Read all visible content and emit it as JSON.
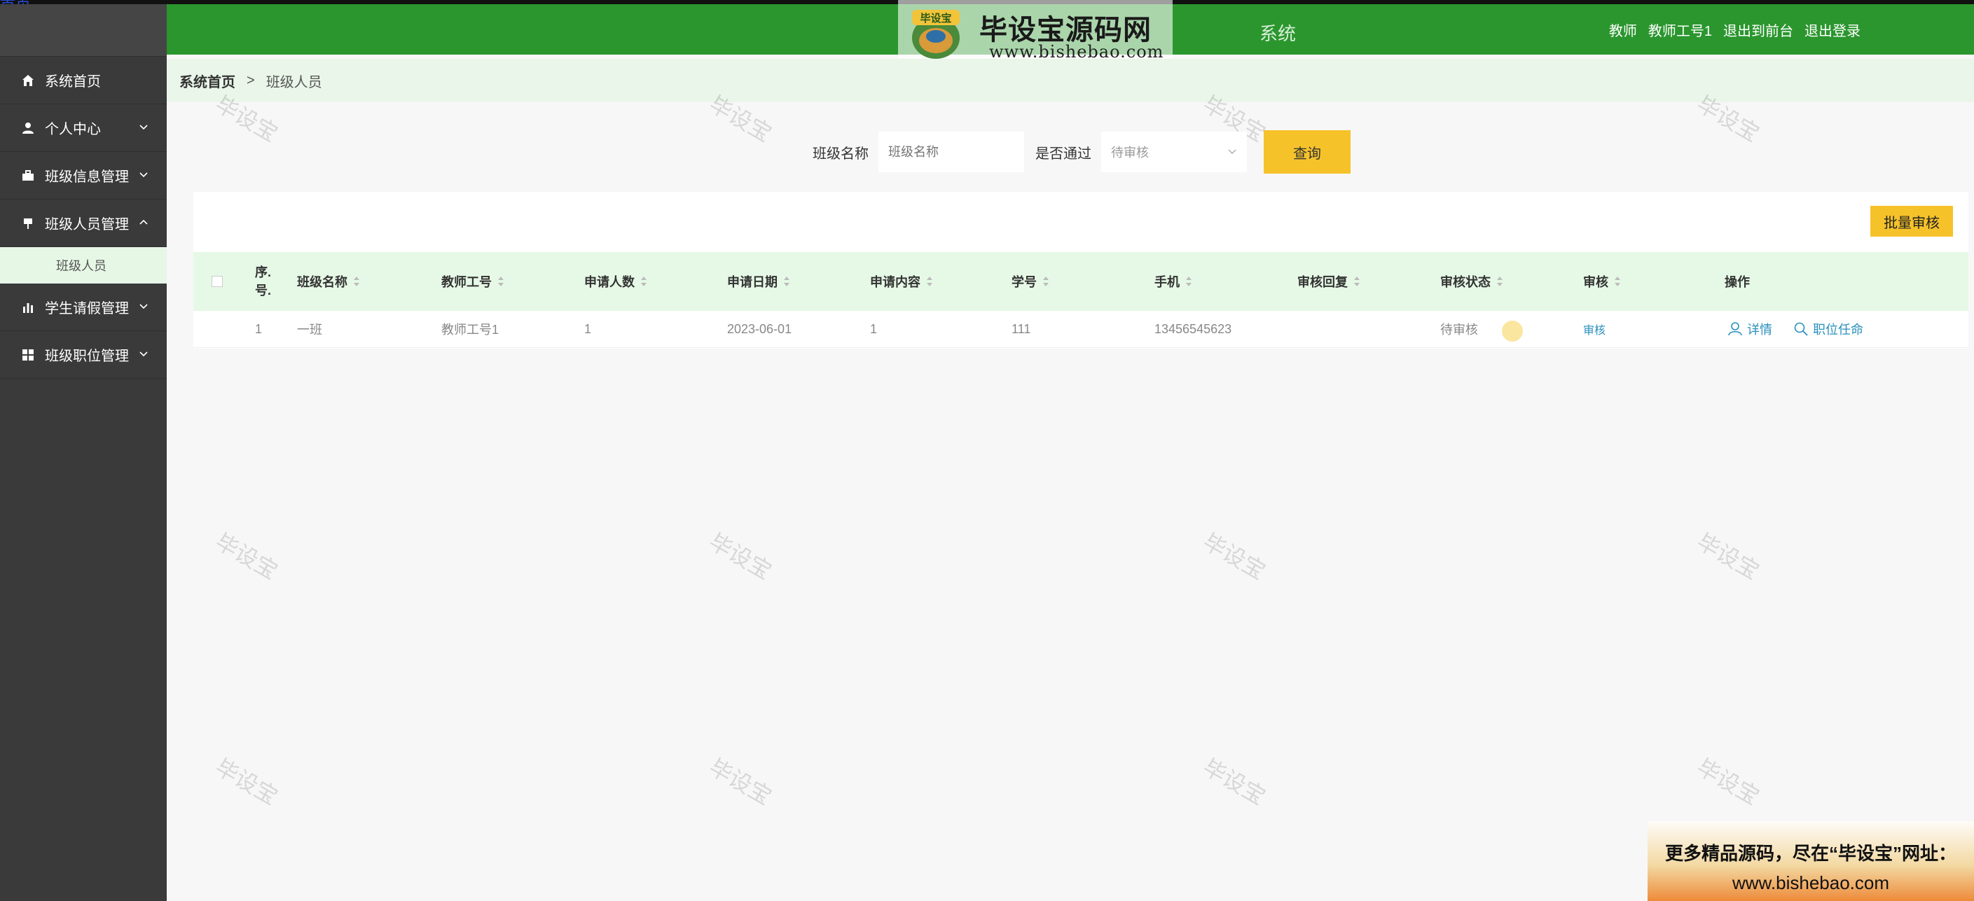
{
  "top_strip_label": "首页",
  "header": {
    "brand_name": "毕设宝源码网",
    "brand_url": "www.bishebao.com",
    "brand_logo_text": "毕设宝",
    "system_title": "系统",
    "user_role": "教师",
    "user_name": "教师工号1",
    "link_front": "退出到前台",
    "link_logout": "退出登录"
  },
  "sidebar": {
    "items": [
      {
        "label": "系统首页",
        "icon": "home-icon"
      },
      {
        "label": "个人中心",
        "icon": "user-icon"
      },
      {
        "label": "班级信息管理",
        "icon": "briefcase-icon"
      },
      {
        "label": "班级人员管理",
        "icon": "flag-icon"
      },
      {
        "label": "学生请假管理",
        "icon": "bar-chart-icon"
      },
      {
        "label": "班级职位管理",
        "icon": "grid-icon"
      }
    ],
    "sub_item": "班级人员"
  },
  "breadcrumb": {
    "home": "系统首页",
    "separator": ">",
    "current": "班级人员"
  },
  "search": {
    "class_name_label": "班级名称",
    "class_name_placeholder": "班级名称",
    "passed_label": "是否通过",
    "passed_value": "待审核",
    "query_button": "查询"
  },
  "table": {
    "batch_button": "批量审核",
    "columns": {
      "index_line1": "序.",
      "index_line2": "号.",
      "class_name": "班级名称",
      "teacher_no": "教师工号",
      "applicants": "申请人数",
      "apply_date": "申请日期",
      "apply_content": "申请内容",
      "student_no": "学号",
      "phone": "手机",
      "review_reply": "审核回复",
      "review_status": "审核状态",
      "review": "审核",
      "actions": "操作"
    },
    "rows": [
      {
        "index": "1",
        "class_name": "一班",
        "teacher_no": "教师工号1",
        "applicants": "1",
        "apply_date": "2023-06-01",
        "apply_content": "1",
        "student_no": "111",
        "phone": "13456545623",
        "review_reply": "",
        "review_status": "待审核",
        "review_link": "审核",
        "action_detail": "详情",
        "action_appoint": "职位任命"
      }
    ]
  },
  "watermark_text": "毕设宝",
  "ad": {
    "line1": "更多精品源码，尽在“毕设宝”网址：",
    "line2": "www.bishebao.com"
  },
  "colors": {
    "header_green": "#2b962e",
    "sidebar_bg": "#3a3a3a",
    "accent_yellow": "#f6c22a",
    "link_blue": "#2a8fbd"
  }
}
